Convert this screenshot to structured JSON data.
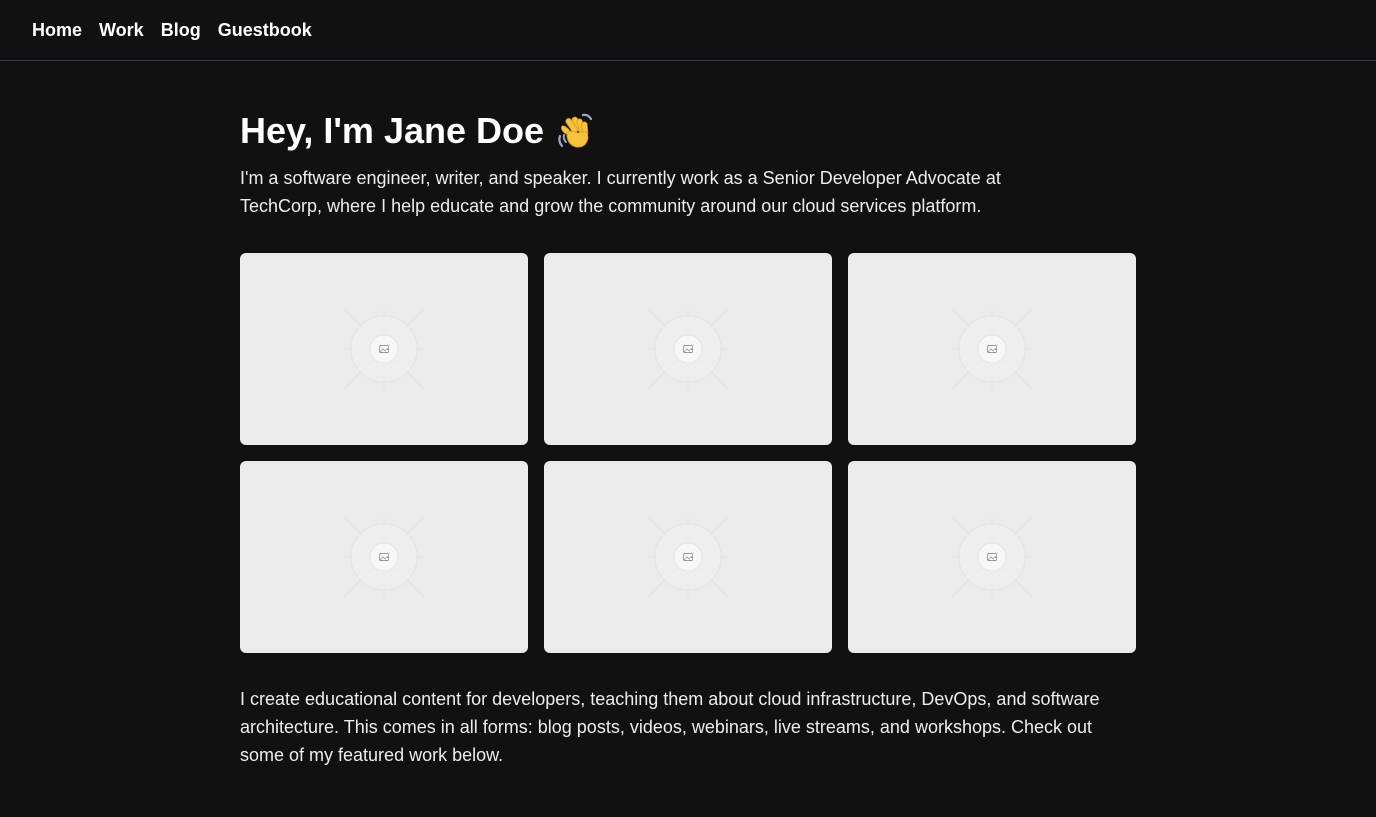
{
  "nav": {
    "items": [
      {
        "label": "Home"
      },
      {
        "label": "Work"
      },
      {
        "label": "Blog"
      },
      {
        "label": "Guestbook"
      }
    ]
  },
  "hero": {
    "title": "Hey, I'm Jane Doe",
    "emoji_icon": "waving-hand-icon",
    "intro": "I'm a software engineer, writer, and speaker. I currently work as a Senior Developer Advocate at TechCorp, where I help educate and grow the community around our cloud services platform."
  },
  "gallery": {
    "tile_count": 6,
    "placeholder_icon": "image-placeholder-icon"
  },
  "outro": {
    "text": "I create educational content for developers, teaching them about cloud infrastructure, DevOps, and software architecture. This comes in all forms: blog posts, videos, webinars, live streams, and workshops. Check out some of my featured work below."
  },
  "colors": {
    "background": "#111111",
    "tile": "#ebebeb",
    "divider": "#3a3c44",
    "text": "#ededed"
  }
}
